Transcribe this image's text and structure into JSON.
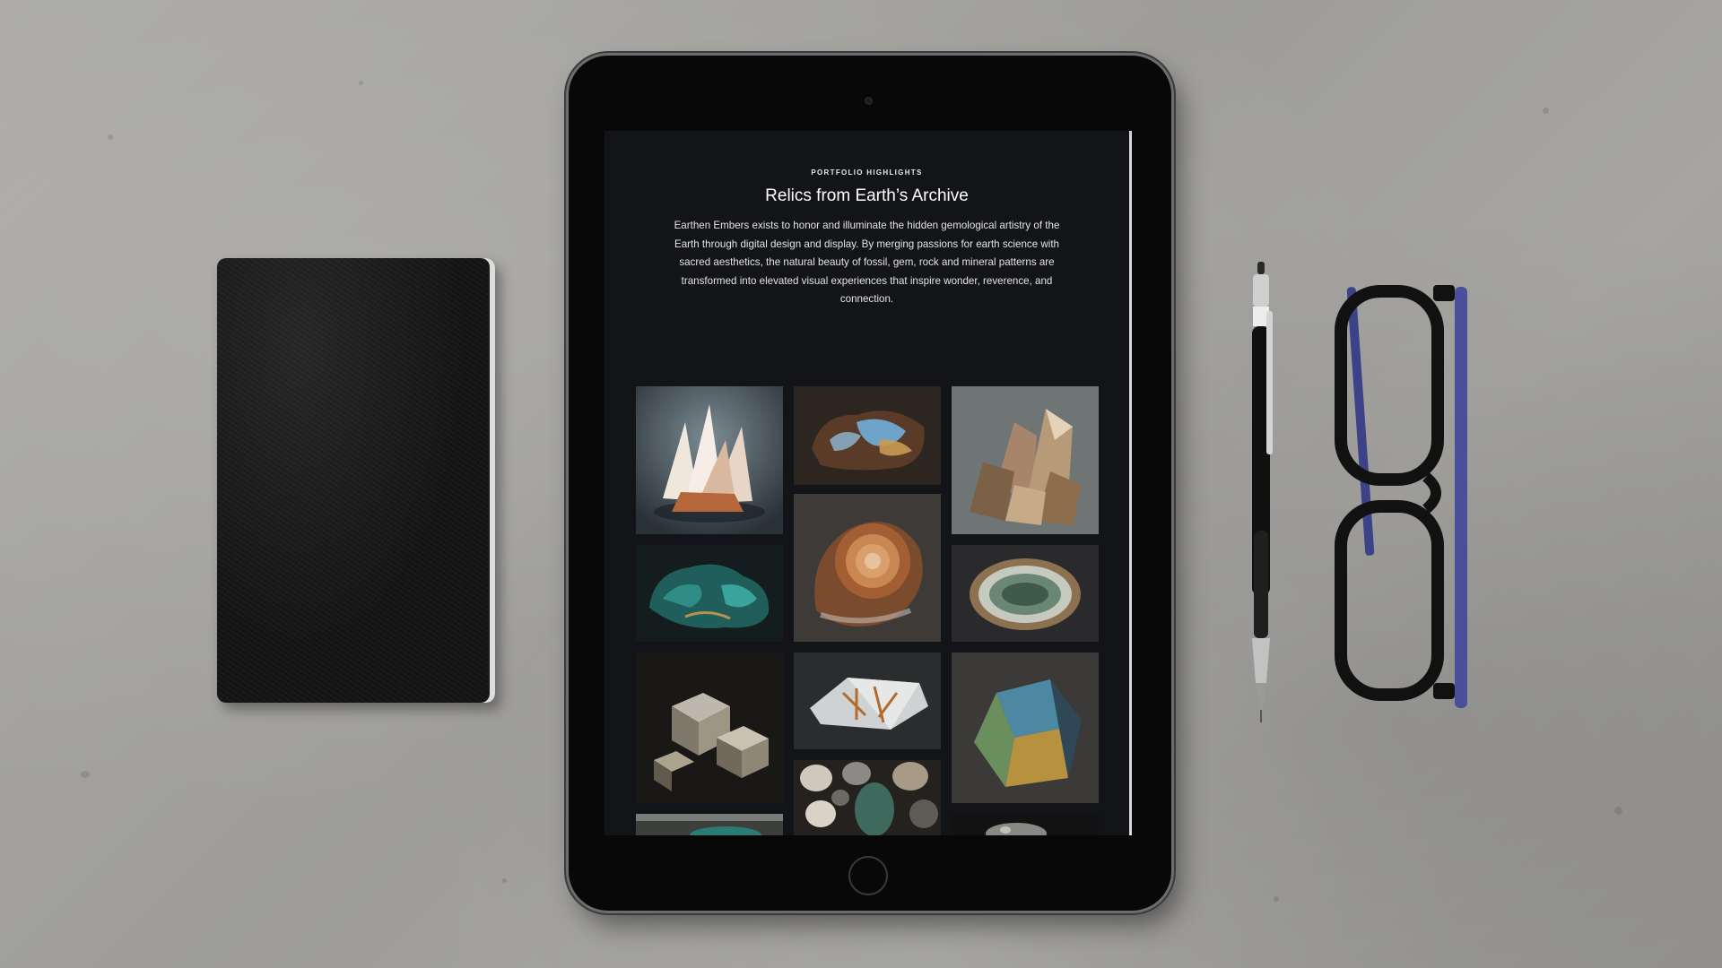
{
  "page": {
    "eyebrow": "PORTFOLIO HIGHLIGHTS",
    "title": "Relics from Earth’s Archive",
    "intro": "Earthen Embers exists to honor and illuminate the hidden gemological artistry of the Earth through digital design and display. By merging passions for earth science with sacred aesthetics, the natural beauty of fossil, gem, rock and mineral patterns are transformed into elevated visual experiences that inspire wonder, reverence, and connection."
  },
  "gallery": [
    {
      "name": "selenite-cluster-photo"
    },
    {
      "name": "opal-stone-photo"
    },
    {
      "name": "smoky-quartz-cluster-photo"
    },
    {
      "name": "chrysocolla-stone-photo"
    },
    {
      "name": "ammonite-fossil-photo"
    },
    {
      "name": "agate-geode-photo"
    },
    {
      "name": "pyrite-cubes-photo"
    },
    {
      "name": "rutilated-quartz-photo"
    },
    {
      "name": "labradorite-stone-photo"
    },
    {
      "name": "polished-stones-photo"
    },
    {
      "name": "turquoise-stone-photo"
    },
    {
      "name": "mineral-cluster-photo"
    }
  ],
  "colors": {
    "screen_bg": "#131417",
    "desk": "#a3a29f",
    "accent_blue": "#4a4f9a"
  }
}
